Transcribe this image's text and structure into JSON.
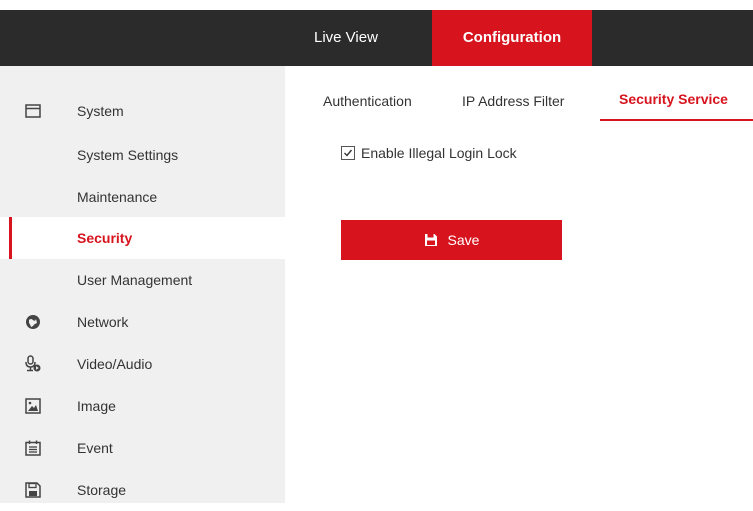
{
  "topnav": {
    "items": [
      {
        "label": "Live View",
        "active": false
      },
      {
        "label": "Configuration",
        "active": true
      }
    ]
  },
  "sidebar": {
    "items": [
      {
        "label": "System",
        "icon": "system-icon",
        "level": 0
      },
      {
        "label": "System Settings",
        "level": 1
      },
      {
        "label": "Maintenance",
        "level": 1
      },
      {
        "label": "Security",
        "level": 1,
        "active": true
      },
      {
        "label": "User Management",
        "level": 1
      },
      {
        "label": "Network",
        "icon": "globe-icon",
        "level": 0
      },
      {
        "label": "Video/Audio",
        "icon": "microphone-icon",
        "level": 0
      },
      {
        "label": "Image",
        "icon": "image-icon",
        "level": 0
      },
      {
        "label": "Event",
        "icon": "calendar-icon",
        "level": 0
      },
      {
        "label": "Storage",
        "icon": "storage-icon",
        "level": 0
      }
    ]
  },
  "tabs": [
    {
      "label": "Authentication"
    },
    {
      "label": "IP Address Filter"
    },
    {
      "label": "Security Service",
      "active": true
    }
  ],
  "content": {
    "checkbox_label": "Enable Illegal Login Lock",
    "checkbox_checked": true,
    "save_label": "Save"
  },
  "colors": {
    "accent": "#d7141e",
    "topbar": "#2b2b2b",
    "sidebar_bg": "#f0f0f0"
  }
}
